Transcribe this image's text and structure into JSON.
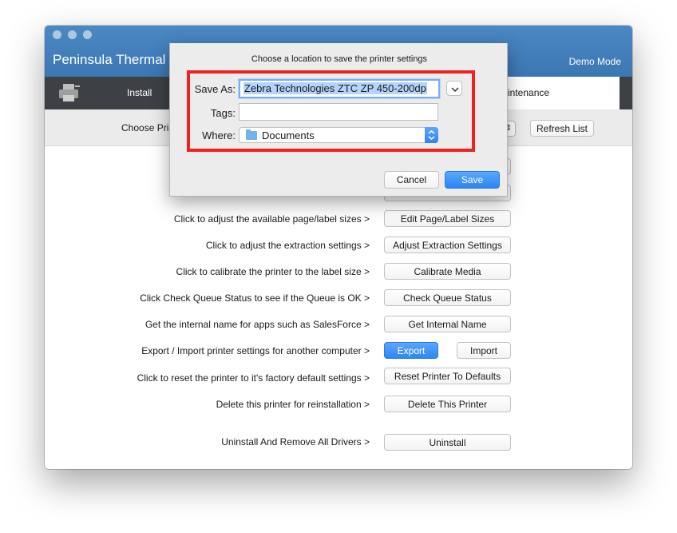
{
  "app": {
    "title": "Peninsula Thermal",
    "mode": "Demo Mode"
  },
  "toolbar": {
    "tabs": [
      {
        "label": "Install"
      },
      {
        "label": "intenance"
      }
    ]
  },
  "printer_select": {
    "label": "Choose Pri",
    "refresh_label": "Refresh List"
  },
  "rows": [
    {
      "label": "Click to adjust the available page/label sizes >",
      "button": "Edit Page/Label Sizes"
    },
    {
      "label": "Click to adjust the extraction settings >",
      "button": "Adjust Extraction Settings"
    },
    {
      "label": "Click to calibrate the printer to the label size >",
      "button": "Calibrate Media"
    },
    {
      "label": "Click Check Queue Status to see if the Queue is OK >",
      "button": "Check Queue Status"
    },
    {
      "label": "Get the internal name for apps such as SalesForce >",
      "button": "Get Internal Name"
    },
    {
      "label": "Export / Import printer settings for another computer >",
      "button": "Export",
      "button2": "Import"
    },
    {
      "label": "Click to reset the printer to it's factory default settings >",
      "button": "Reset Printer To Defaults"
    },
    {
      "label": "Delete this printer for reinstallation >",
      "button": "Delete This Printer"
    },
    {
      "label": "Uninstall And Remove All Drivers >",
      "button": "Uninstall"
    }
  ],
  "dialog": {
    "title": "Choose a location to save the printer settings",
    "save_as_label": "Save As:",
    "save_as_value": "Zebra Technologies ZTC ZP 450-200dp",
    "tags_label": "Tags:",
    "tags_value": "",
    "where_label": "Where:",
    "where_value": "Documents",
    "cancel_label": "Cancel",
    "save_label": "Save",
    "highlight_color": "#ee2222"
  },
  "colors": {
    "titlebar": "#4580bd",
    "toolbar": "#3d4145",
    "accent": "#2e86f5"
  }
}
